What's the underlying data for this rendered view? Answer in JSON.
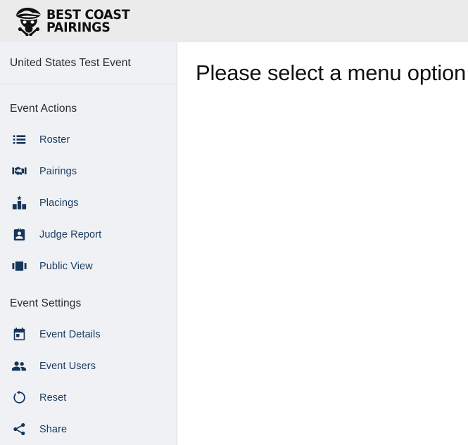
{
  "header": {
    "brand": {
      "logo_icon": "pirate-skull-logo-icon",
      "line1": "BEST COAST",
      "line2": "PAIRINGS"
    },
    "background_color": "#ebebeb"
  },
  "sidebar": {
    "background_color": "#eff1f5",
    "accent_color": "#1b3a5e",
    "event_name": "United States Test Event",
    "sections": [
      {
        "title": "Event Actions",
        "items": [
          {
            "label": "Roster",
            "icon": "list-icon"
          },
          {
            "label": "Pairings",
            "icon": "handshake-icon"
          },
          {
            "label": "Placings",
            "icon": "leaderboard-icon"
          },
          {
            "label": "Judge Report",
            "icon": "badge-icon"
          },
          {
            "label": "Public View",
            "icon": "view-carousel-icon"
          }
        ]
      },
      {
        "title": "Event Settings",
        "items": [
          {
            "label": "Event Details",
            "icon": "calendar-icon"
          },
          {
            "label": "Event Users",
            "icon": "people-icon"
          },
          {
            "label": "Reset",
            "icon": "rotate-refresh-icon"
          },
          {
            "label": "Share",
            "icon": "share-icon"
          }
        ]
      }
    ]
  },
  "main": {
    "heading": "Please select a menu option",
    "background_color": "#ffffff"
  }
}
